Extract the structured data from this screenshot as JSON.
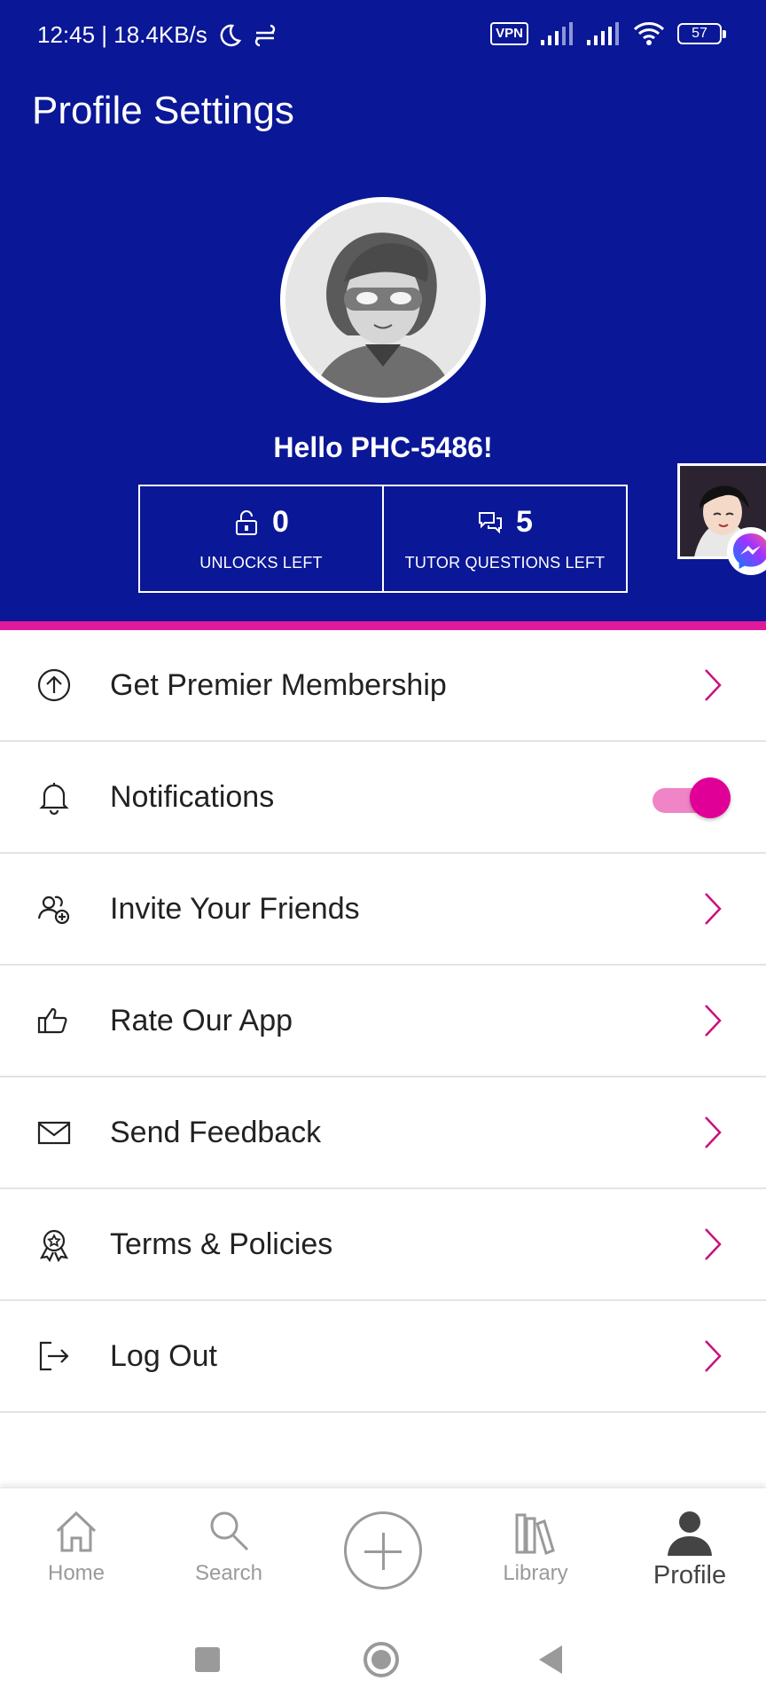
{
  "status_bar": {
    "time_speed": "12:45 | 18.4KB/s",
    "vpn_label": "VPN",
    "battery_level": "57"
  },
  "app_bar": {
    "title": "Profile Settings"
  },
  "profile": {
    "greeting": "Hello PHC-5486!",
    "stats": [
      {
        "value": "0",
        "label": "UNLOCKS LEFT",
        "icon": "unlock-icon"
      },
      {
        "value": "5",
        "label": "TUTOR QUESTIONS LEFT",
        "icon": "chat-icon"
      }
    ]
  },
  "menu": {
    "items": [
      {
        "label": "Get Premier Membership",
        "icon": "arrow-up-circle-icon",
        "control": "chevron"
      },
      {
        "label": "Notifications",
        "icon": "bell-icon",
        "control": "toggle",
        "toggle_on": true
      },
      {
        "label": "Invite Your Friends",
        "icon": "add-friends-icon",
        "control": "chevron"
      },
      {
        "label": "Rate Our App",
        "icon": "thumbs-up-icon",
        "control": "chevron"
      },
      {
        "label": "Send Feedback",
        "icon": "envelope-icon",
        "control": "chevron"
      },
      {
        "label": "Terms & Policies",
        "icon": "award-ribbon-icon",
        "control": "chevron"
      },
      {
        "label": "Log Out",
        "icon": "logout-icon",
        "control": "chevron"
      }
    ]
  },
  "bottom_nav": {
    "items": [
      {
        "label": "Home",
        "icon": "home-icon",
        "active": false
      },
      {
        "label": "Search",
        "icon": "search-icon",
        "active": false
      },
      {
        "label": "",
        "icon": "add-icon",
        "active": false
      },
      {
        "label": "Library",
        "icon": "library-icon",
        "active": false
      },
      {
        "label": "Profile",
        "icon": "profile-icon",
        "active": true
      }
    ]
  },
  "colors": {
    "header_blue": "#0a1796",
    "accent_magenta": "#e10097",
    "divider_pink": "#e0199a"
  }
}
